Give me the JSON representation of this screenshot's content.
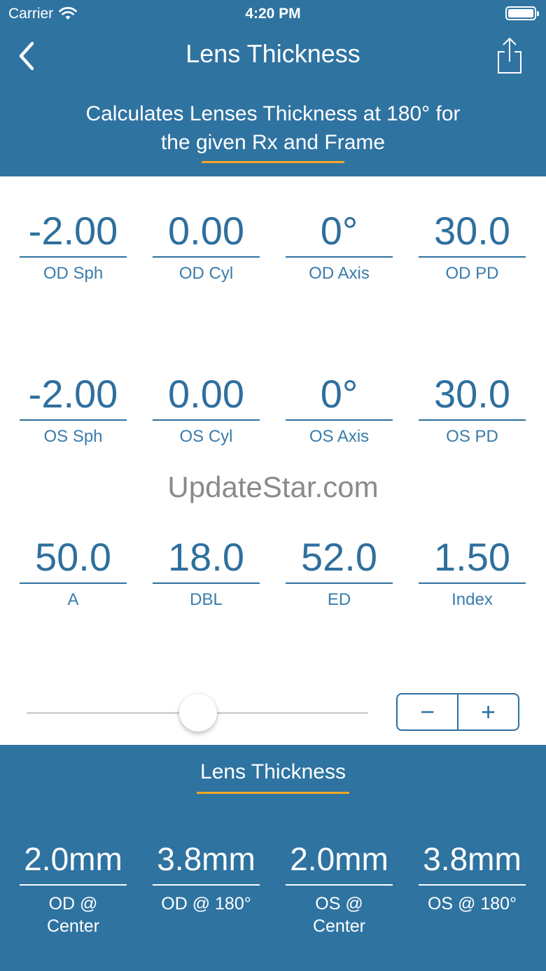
{
  "status_bar": {
    "carrier": "Carrier",
    "time": "4:20 PM"
  },
  "nav": {
    "title": "Lens Thickness"
  },
  "subtitle": {
    "line1": "Calculates Lenses Thickness at 180° for",
    "line2": "the given Rx and Frame"
  },
  "inputs": {
    "od": [
      {
        "value": "-2.00",
        "label": "OD Sph"
      },
      {
        "value": "0.00",
        "label": "OD Cyl"
      },
      {
        "value": "0°",
        "label": "OD Axis"
      },
      {
        "value": "30.0",
        "label": "OD PD"
      }
    ],
    "os": [
      {
        "value": "-2.00",
        "label": "OS Sph"
      },
      {
        "value": "0.00",
        "label": "OS Cyl"
      },
      {
        "value": "0°",
        "label": "OS Axis"
      },
      {
        "value": "30.0",
        "label": "OS PD"
      }
    ],
    "frame": [
      {
        "value": "50.0",
        "label": "A"
      },
      {
        "value": "18.0",
        "label": "DBL"
      },
      {
        "value": "52.0",
        "label": "ED"
      },
      {
        "value": "1.50",
        "label": "Index"
      }
    ]
  },
  "watermark": "UpdateStar.com",
  "stepper": {
    "minus": "−",
    "plus": "+"
  },
  "results": {
    "title": "Lens Thickness",
    "items": [
      {
        "value": "2.0mm",
        "label_line1": "OD @",
        "label_line2": "Center"
      },
      {
        "value": "3.8mm",
        "label_line1": "OD @ 180°",
        "label_line2": ""
      },
      {
        "value": "2.0mm",
        "label_line1": "OS @",
        "label_line2": "Center"
      },
      {
        "value": "3.8mm",
        "label_line1": "OS @ 180°",
        "label_line2": ""
      }
    ]
  },
  "colors": {
    "primary": "#2f73a1",
    "accent": "#f5a623",
    "text": "#2e6f9e"
  },
  "icons": {
    "back": "chevron-left-icon",
    "share": "share-icon",
    "wifi": "wifi-icon",
    "battery": "battery-icon"
  }
}
